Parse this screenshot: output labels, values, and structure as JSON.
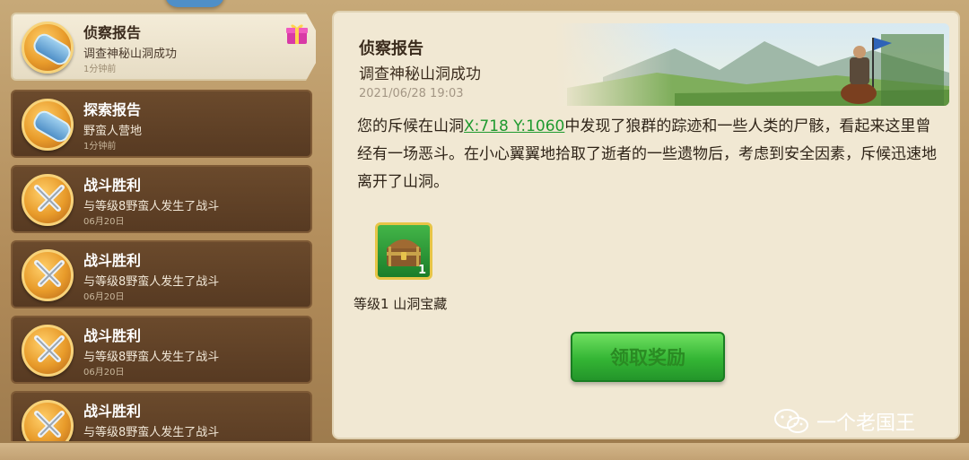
{
  "sidebar": {
    "items": [
      {
        "title": "侦察报告",
        "subtitle": "调查神秘山洞成功",
        "time": "1分钟前",
        "icon": "spyglass-icon",
        "active": true,
        "has_gift": true
      },
      {
        "title": "探索报告",
        "subtitle": "野蛮人营地",
        "time": "1分钟前",
        "icon": "spyglass-icon",
        "active": false
      },
      {
        "title": "战斗胜利",
        "subtitle": "与等级8野蛮人发生了战斗",
        "time": "06月20日",
        "icon": "crossed-swords-icon",
        "active": false
      },
      {
        "title": "战斗胜利",
        "subtitle": "与等级8野蛮人发生了战斗",
        "time": "06月20日",
        "icon": "crossed-swords-icon",
        "active": false
      },
      {
        "title": "战斗胜利",
        "subtitle": "与等级8野蛮人发生了战斗",
        "time": "06月20日",
        "icon": "crossed-swords-icon",
        "active": false
      },
      {
        "title": "战斗胜利",
        "subtitle": "与等级8野蛮人发生了战斗",
        "time": "",
        "icon": "crossed-swords-icon",
        "active": false
      }
    ]
  },
  "report": {
    "title": "侦察报告",
    "subtitle": "调查神秘山洞成功",
    "date": "2021/06/28 19:03",
    "body_before": "您的斥候在山洞",
    "coord_link": "X:718 Y:1060",
    "body_after": "中发现了狼群的踪迹和一些人类的尸骸，看起来这里曾经有一场恶斗。在小心翼翼地拾取了逝者的一些遗物后，考虑到安全因素，斥候迅速地离开了山洞。",
    "reward": {
      "label": "等级1 山洞宝藏",
      "quantity": "1",
      "icon": "treasure-chest-icon"
    },
    "claim_label": "领取奖励"
  },
  "watermark": {
    "text": "一个老国王",
    "icon": "wechat-icon"
  },
  "colors": {
    "accent_green": "#34b534",
    "link_green": "#1f9a2f",
    "panel_bg": "#f1e8d3",
    "item_bg": "#573a22"
  }
}
